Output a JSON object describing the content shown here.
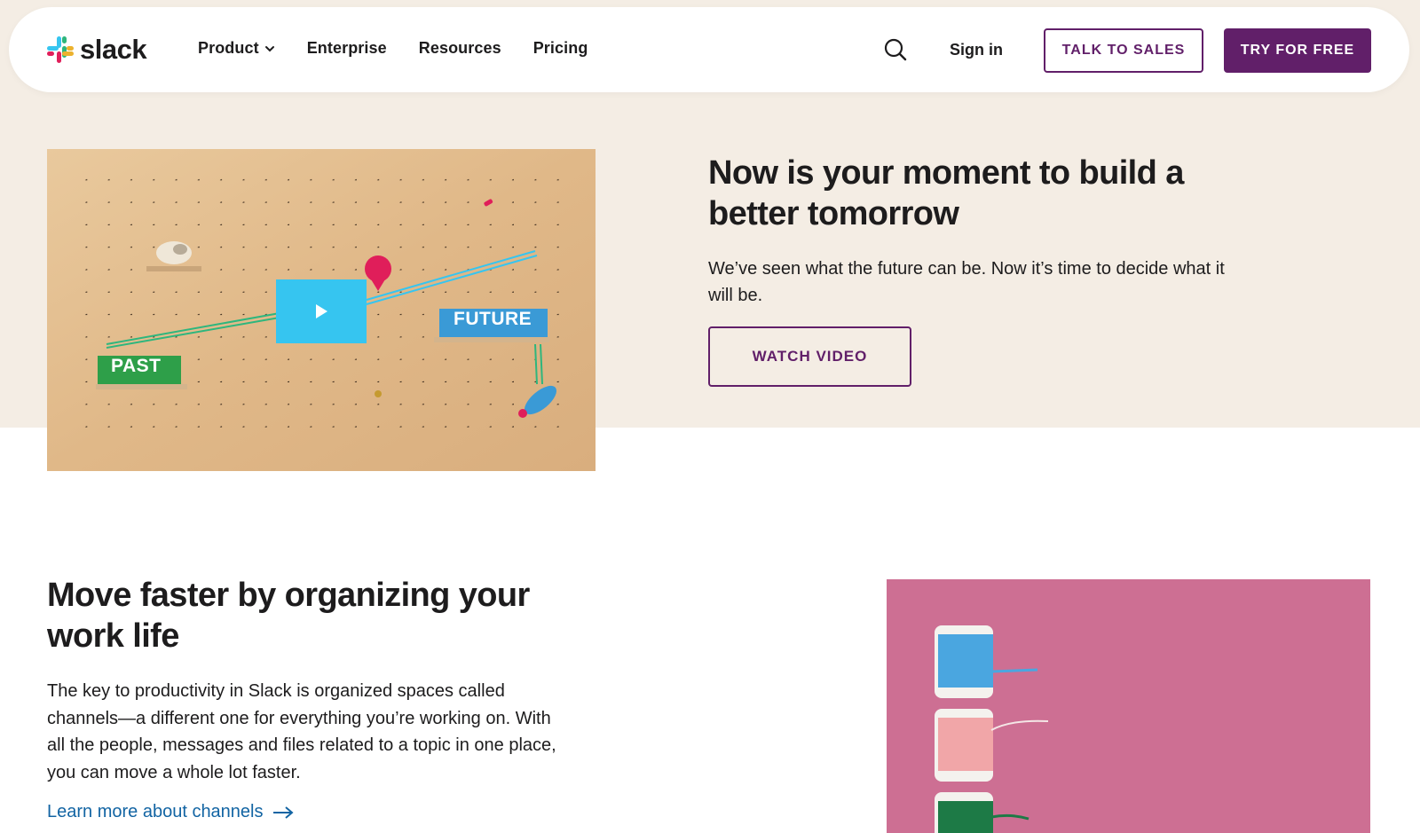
{
  "header": {
    "logo_text": "slack",
    "nav": [
      {
        "label": "Product",
        "has_dropdown": true
      },
      {
        "label": "Enterprise"
      },
      {
        "label": "Resources"
      },
      {
        "label": "Pricing"
      }
    ],
    "sign_in": "Sign in",
    "talk_to_sales": "TALK TO SALES",
    "try_for_free": "TRY FOR FREE"
  },
  "hero": {
    "video_labels": {
      "past": "PAST",
      "future": "FUTURE"
    },
    "title": "Now is your moment to build a better tomorrow",
    "subtitle": "We’ve seen what the future can be. Now it’s time to decide what it will be.",
    "watch_video": "WATCH VIDEO"
  },
  "section2": {
    "title": "Move faster by organizing your work life",
    "body": "The key to productivity in Slack is organized spaces called channels—a different one for everything you’re working on. With all the people, messages and files related to a topic in one place, you can move a whole lot faster.",
    "link": "Learn more about channels"
  },
  "colors": {
    "brand_purple": "#611f69",
    "hero_bg": "#f4ede4",
    "link_blue": "#1264a3",
    "pink_panel": "#cd6f93"
  },
  "icons": [
    "slack-logo-icon",
    "chevron-down-icon",
    "search-icon",
    "play-icon",
    "arrow-right-icon"
  ]
}
